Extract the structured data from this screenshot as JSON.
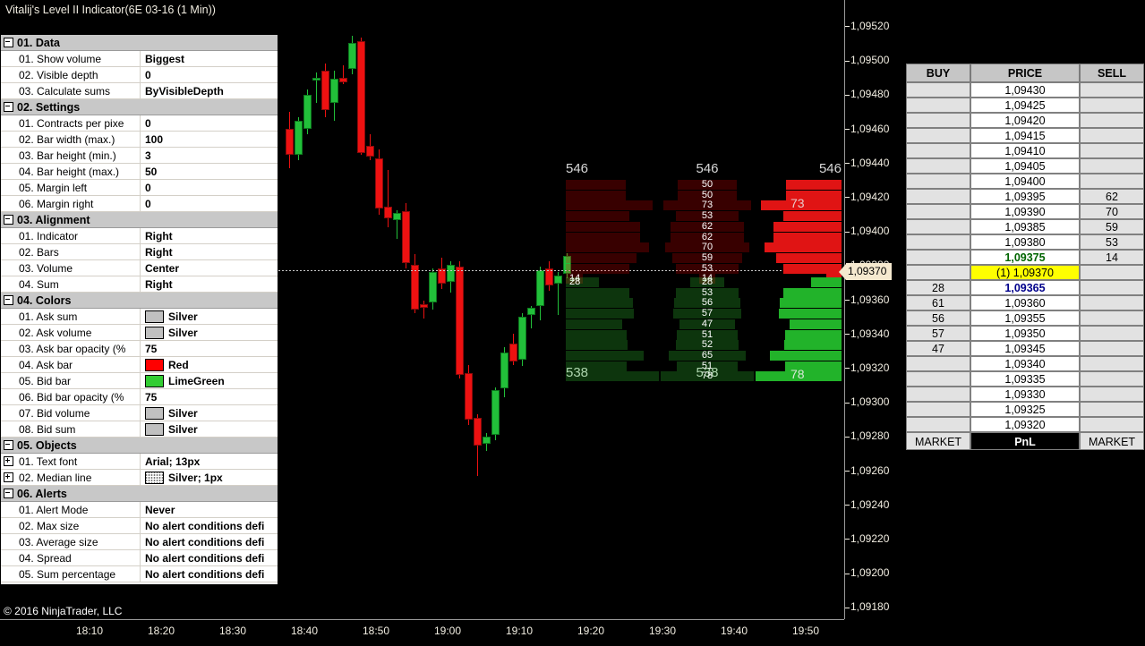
{
  "window": {
    "title": "Vitalij's Level II Indicator(6E 03-16 (1 Min))",
    "skip_icon": "play-to-end-icon",
    "copyright": "© 2016 NinjaTrader, LLC"
  },
  "properties": {
    "groups": [
      {
        "label": "01. Data",
        "expander": "minus",
        "rows": [
          {
            "name": "01. Show volume",
            "value": "Biggest"
          },
          {
            "name": "02. Visible depth",
            "value": "0"
          },
          {
            "name": "03. Calculate sums",
            "value": "ByVisibleDepth"
          }
        ]
      },
      {
        "label": "02. Settings",
        "expander": "minus",
        "rows": [
          {
            "name": "01. Contracts per pixe",
            "value": "0"
          },
          {
            "name": "02. Bar width (max.)",
            "value": "100"
          },
          {
            "name": "03. Bar height (min.)",
            "value": "3"
          },
          {
            "name": "04. Bar height (max.)",
            "value": "50"
          },
          {
            "name": "05. Margin left",
            "value": "0"
          },
          {
            "name": "06. Margin right",
            "value": "0"
          }
        ]
      },
      {
        "label": "03. Alignment",
        "expander": "minus",
        "rows": [
          {
            "name": "01. Indicator",
            "value": "Right"
          },
          {
            "name": "02. Bars",
            "value": "Right"
          },
          {
            "name": "03. Volume",
            "value": "Center"
          },
          {
            "name": "04. Sum",
            "value": "Right"
          }
        ]
      },
      {
        "label": "04. Colors",
        "expander": "minus",
        "rows": [
          {
            "name": "01. Ask sum",
            "value": "Silver",
            "swatch": "#c0c0c0"
          },
          {
            "name": "02. Ask volume",
            "value": "Silver",
            "swatch": "#c0c0c0"
          },
          {
            "name": "03. Ask bar opacity (%",
            "value": "75"
          },
          {
            "name": "04. Ask bar",
            "value": "Red",
            "swatch": "#ff0000"
          },
          {
            "name": "05. Bid bar",
            "value": "LimeGreen",
            "swatch": "#32cd32"
          },
          {
            "name": "06. Bid bar opacity (%",
            "value": "75"
          },
          {
            "name": "07. Bid volume",
            "value": "Silver",
            "swatch": "#c0c0c0"
          },
          {
            "name": "08. Bid sum",
            "value": "Silver",
            "swatch": "#c0c0c0"
          }
        ]
      },
      {
        "label": "05. Objects",
        "expander": "minus",
        "rows": [
          {
            "name": "01. Text font",
            "value": "Arial; 13px",
            "expander": "plus"
          },
          {
            "name": "02. Median line",
            "value": "Silver; 1px",
            "expander": "plus",
            "swatch": "dots"
          }
        ]
      },
      {
        "label": "06. Alerts",
        "expander": "minus",
        "rows": [
          {
            "name": "01. Alert Mode",
            "value": "Never"
          },
          {
            "name": "02. Max size",
            "value": "No alert conditions defi"
          },
          {
            "name": "03. Average size",
            "value": "No alert conditions defi"
          },
          {
            "name": "04. Spread",
            "value": "No alert conditions defi"
          },
          {
            "name": "05. Sum percentage",
            "value": "No alert conditions defi"
          }
        ]
      }
    ]
  },
  "chart_data": {
    "type": "candlestick",
    "title": "6E 03-16 (1 Min)",
    "xlabel": "",
    "ylabel": "",
    "grid": false,
    "ylim": [
      1.0917,
      1.0953
    ],
    "y_ticks": [
      "1,09520",
      "1,09500",
      "1,09480",
      "1,09460",
      "1,09440",
      "1,09420",
      "1,09400",
      "1,09380",
      "1,09360",
      "1,09340",
      "1,09320",
      "1,09300",
      "1,09280",
      "1,09260",
      "1,09240",
      "1,09220",
      "1,09200",
      "1,09180"
    ],
    "x_ticks": [
      "18:10",
      "18:20",
      "18:30",
      "18:40",
      "18:50",
      "19:00",
      "19:10",
      "19:20",
      "19:30",
      "19:40",
      "19:50"
    ],
    "median_line_price": "1,09370",
    "current_price_marker": "1,09370",
    "up_color": "#22c03a",
    "down_color": "#ee1111",
    "candles": [
      {
        "t": "18:47",
        "o": 1.09455,
        "h": 1.09465,
        "l": 1.09432,
        "c": 1.0944,
        "dir": "down"
      },
      {
        "t": "18:48",
        "o": 1.0944,
        "h": 1.09462,
        "l": 1.09437,
        "c": 1.0946,
        "dir": "up"
      },
      {
        "t": "18:49",
        "o": 1.09455,
        "h": 1.09478,
        "l": 1.09452,
        "c": 1.09475,
        "dir": "up"
      },
      {
        "t": "18:50",
        "o": 1.09483,
        "h": 1.09488,
        "l": 1.0947,
        "c": 1.09485,
        "dir": "up"
      },
      {
        "t": "18:51",
        "o": 1.09489,
        "h": 1.09493,
        "l": 1.09462,
        "c": 1.09466,
        "dir": "down"
      },
      {
        "t": "18:52",
        "o": 1.0947,
        "h": 1.09489,
        "l": 1.0946,
        "c": 1.09484,
        "dir": "up"
      },
      {
        "t": "18:53",
        "o": 1.09485,
        "h": 1.09492,
        "l": 1.09481,
        "c": 1.09482,
        "dir": "down"
      },
      {
        "t": "18:54",
        "o": 1.0949,
        "h": 1.09509,
        "l": 1.09487,
        "c": 1.09505,
        "dir": "up"
      },
      {
        "t": "18:55",
        "o": 1.09506,
        "h": 1.09508,
        "l": 1.0944,
        "c": 1.09441,
        "dir": "down"
      },
      {
        "t": "18:56",
        "o": 1.09445,
        "h": 1.09452,
        "l": 1.09437,
        "c": 1.09439,
        "dir": "down"
      },
      {
        "t": "18:57",
        "o": 1.09438,
        "h": 1.09443,
        "l": 1.09405,
        "c": 1.09409,
        "dir": "down"
      },
      {
        "t": "18:58",
        "o": 1.0941,
        "h": 1.09431,
        "l": 1.09398,
        "c": 1.09403,
        "dir": "down"
      },
      {
        "t": "18:59",
        "o": 1.09402,
        "h": 1.09408,
        "l": 1.09391,
        "c": 1.09406,
        "dir": "up"
      },
      {
        "t": "19:00",
        "o": 1.09407,
        "h": 1.09412,
        "l": 1.09374,
        "c": 1.09377,
        "dir": "down"
      },
      {
        "t": "19:01",
        "o": 1.09376,
        "h": 1.09382,
        "l": 1.09348,
        "c": 1.0935,
        "dir": "down"
      },
      {
        "t": "19:02",
        "o": 1.09351,
        "h": 1.09355,
        "l": 1.09345,
        "c": 1.09353,
        "dir": "down"
      },
      {
        "t": "19:03",
        "o": 1.09354,
        "h": 1.09374,
        "l": 1.0935,
        "c": 1.09372,
        "dir": "up"
      },
      {
        "t": "19:04",
        "o": 1.09374,
        "h": 1.0938,
        "l": 1.09362,
        "c": 1.09365,
        "dir": "down"
      },
      {
        "t": "19:05",
        "o": 1.09366,
        "h": 1.09378,
        "l": 1.0936,
        "c": 1.09376,
        "dir": "up"
      },
      {
        "t": "19:06",
        "o": 1.09375,
        "h": 1.09378,
        "l": 1.0931,
        "c": 1.09312,
        "dir": "down"
      },
      {
        "t": "19:07",
        "o": 1.09313,
        "h": 1.09318,
        "l": 1.09283,
        "c": 1.09286,
        "dir": "down"
      },
      {
        "t": "19:08",
        "o": 1.09287,
        "h": 1.09289,
        "l": 1.09253,
        "c": 1.09271,
        "dir": "down"
      },
      {
        "t": "19:09",
        "o": 1.09272,
        "h": 1.09278,
        "l": 1.09268,
        "c": 1.09276,
        "dir": "up"
      },
      {
        "t": "19:10",
        "o": 1.09277,
        "h": 1.09305,
        "l": 1.09274,
        "c": 1.09303,
        "dir": "up"
      },
      {
        "t": "19:11",
        "o": 1.09304,
        "h": 1.09328,
        "l": 1.09299,
        "c": 1.09325,
        "dir": "up"
      },
      {
        "t": "19:12",
        "o": 1.0933,
        "h": 1.09336,
        "l": 1.09318,
        "c": 1.0932,
        "dir": "down"
      },
      {
        "t": "19:13",
        "o": 1.09321,
        "h": 1.09348,
        "l": 1.09317,
        "c": 1.09346,
        "dir": "up"
      },
      {
        "t": "19:14",
        "o": 1.09347,
        "h": 1.09352,
        "l": 1.09339,
        "c": 1.09351,
        "dir": "up"
      },
      {
        "t": "19:15",
        "o": 1.09352,
        "h": 1.09375,
        "l": 1.09344,
        "c": 1.09373,
        "dir": "up"
      },
      {
        "t": "19:16",
        "o": 1.09374,
        "h": 1.09378,
        "l": 1.09361,
        "c": 1.09364,
        "dir": "down"
      },
      {
        "t": "19:17",
        "o": 1.09365,
        "h": 1.09372,
        "l": 1.09347,
        "c": 1.0937,
        "dir": "up"
      },
      {
        "t": "19:18",
        "o": 1.09371,
        "h": 1.09383,
        "l": 1.09368,
        "c": 1.09381,
        "dir": "up"
      }
    ]
  },
  "level2": {
    "ask_sum": "546",
    "bid_sum": "538",
    "ask_sum_labels": [
      "546",
      "546",
      "546"
    ],
    "bid_sum_labels": [
      "538",
      "538",
      "538"
    ],
    "ask_highlight_value": "73",
    "bid_highlight_value": "78",
    "ask_first_label": "14",
    "bid_first_label": "28",
    "ask_levels": [
      {
        "price": "1,09420",
        "volume": 50
      },
      {
        "price": "1,09415",
        "volume": 50
      },
      {
        "price": "1,09410",
        "volume": 73
      },
      {
        "price": "1,09405",
        "volume": 53
      },
      {
        "price": "1,09400",
        "volume": 62
      },
      {
        "price": "1,09395",
        "volume": 62
      },
      {
        "price": "1,09390",
        "volume": 70
      },
      {
        "price": "1,09385",
        "volume": 59
      },
      {
        "price": "1,09380",
        "volume": 53
      },
      {
        "price": "1,09375",
        "volume": 14
      }
    ],
    "bid_levels": [
      {
        "price": "1,09365",
        "volume": 28
      },
      {
        "price": "1,09360",
        "volume": 53
      },
      {
        "price": "1,09355",
        "volume": 56
      },
      {
        "price": "1,09350",
        "volume": 57
      },
      {
        "price": "1,09345",
        "volume": 47
      },
      {
        "price": "1,09340",
        "volume": 51
      },
      {
        "price": "1,09335",
        "volume": 52
      },
      {
        "price": "1,09330",
        "volume": 65
      },
      {
        "price": "1,09325",
        "volume": 51
      },
      {
        "price": "1,09320",
        "volume": 78
      }
    ]
  },
  "dom": {
    "headers": {
      "buy": "BUY",
      "price": "PRICE",
      "sell": "SELL"
    },
    "footer": {
      "buy": "MARKET",
      "pnl": "PnL",
      "sell": "MARKET"
    },
    "rows": [
      {
        "buy": "",
        "price": "1,09430",
        "sell": "",
        "state": ""
      },
      {
        "buy": "",
        "price": "1,09425",
        "sell": "",
        "state": ""
      },
      {
        "buy": "",
        "price": "1,09420",
        "sell": "",
        "state": ""
      },
      {
        "buy": "",
        "price": "1,09415",
        "sell": "",
        "state": ""
      },
      {
        "buy": "",
        "price": "1,09410",
        "sell": "",
        "state": ""
      },
      {
        "buy": "",
        "price": "1,09405",
        "sell": "",
        "state": ""
      },
      {
        "buy": "",
        "price": "1,09400",
        "sell": "",
        "state": ""
      },
      {
        "buy": "",
        "price": "1,09395",
        "sell": "62",
        "state": ""
      },
      {
        "buy": "",
        "price": "1,09390",
        "sell": "70",
        "state": ""
      },
      {
        "buy": "",
        "price": "1,09385",
        "sell": "59",
        "state": ""
      },
      {
        "buy": "",
        "price": "1,09380",
        "sell": "53",
        "state": ""
      },
      {
        "buy": "",
        "price": "1,09375",
        "sell": "14",
        "state": "last"
      },
      {
        "buy": "",
        "price": "(1) 1,09370",
        "sell": "",
        "state": "mkt"
      },
      {
        "buy": "28",
        "price": "1,09365",
        "sell": "",
        "state": "bidbest"
      },
      {
        "buy": "61",
        "price": "1,09360",
        "sell": "",
        "state": ""
      },
      {
        "buy": "56",
        "price": "1,09355",
        "sell": "",
        "state": ""
      },
      {
        "buy": "57",
        "price": "1,09350",
        "sell": "",
        "state": ""
      },
      {
        "buy": "47",
        "price": "1,09345",
        "sell": "",
        "state": ""
      },
      {
        "buy": "",
        "price": "1,09340",
        "sell": "",
        "state": ""
      },
      {
        "buy": "",
        "price": "1,09335",
        "sell": "",
        "state": ""
      },
      {
        "buy": "",
        "price": "1,09330",
        "sell": "",
        "state": ""
      },
      {
        "buy": "",
        "price": "1,09325",
        "sell": "",
        "state": ""
      },
      {
        "buy": "",
        "price": "1,09320",
        "sell": "",
        "state": ""
      }
    ]
  }
}
